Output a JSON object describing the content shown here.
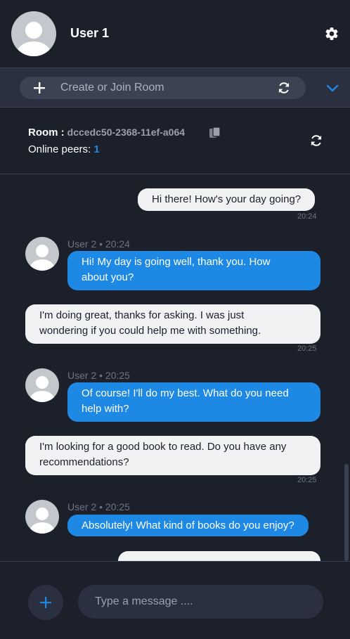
{
  "header": {
    "username": "User 1"
  },
  "room_bar": {
    "placeholder": "Create or Join Room"
  },
  "room_info": {
    "room_label": "Room :",
    "room_id": "dccedc50-2368-11ef-a064",
    "peers_label": "Online peers:",
    "peers_count": "1"
  },
  "messages": [
    {
      "direction": "out",
      "lines": [
        "Hi there! How's your day going?"
      ],
      "time": "20:24"
    },
    {
      "direction": "in",
      "sender": "User 2 • 20:24",
      "lines": [
        "Hi! My day is going well, thank you. How",
        "about you?"
      ]
    },
    {
      "direction": "out",
      "lines": [
        "I'm doing great, thanks for asking. I was just",
        "wondering if you could help me with something."
      ],
      "time": "20:25"
    },
    {
      "direction": "in",
      "sender": "User 2 • 20:25",
      "lines": [
        "Of course! I'll do my best. What do you need",
        "help with?"
      ]
    },
    {
      "direction": "out",
      "lines": [
        "I'm looking for a good book to read. Do you have any",
        "recommendations?"
      ],
      "time": "20:25"
    },
    {
      "direction": "in",
      "sender": "User 2 • 20:25",
      "lines": [
        "Absolutely! What kind of books do you enjoy?"
      ]
    }
  ],
  "composer": {
    "placeholder": "Type a message ...."
  },
  "colors": {
    "background": "#1b202b",
    "accent": "#1e88e5",
    "outgoing_bubble": "#f1f2f4",
    "panel": "#2a3040"
  }
}
